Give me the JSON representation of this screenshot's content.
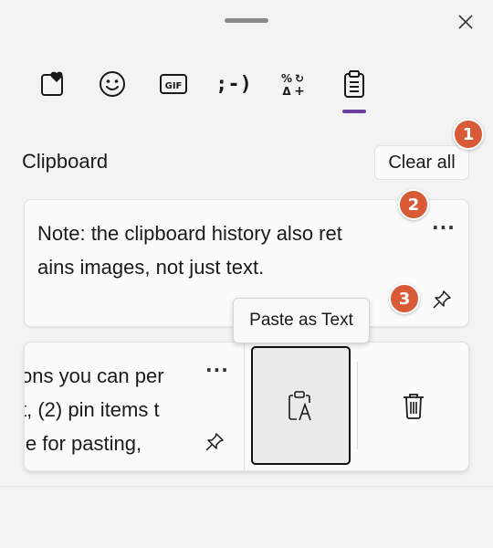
{
  "tabs": [
    {
      "name": "heart-icon",
      "label": ""
    },
    {
      "name": "smiley-icon",
      "label": ""
    },
    {
      "name": "gif-icon",
      "label": "GIF"
    },
    {
      "name": "kaomoji-icon",
      "label": ";-)"
    },
    {
      "name": "symbols-icon",
      "label": "%↻Δ+"
    },
    {
      "name": "clipboard-icon",
      "label": ""
    }
  ],
  "active_tab": "clipboard",
  "section": {
    "title": "Clipboard",
    "clear_all_label": "Clear all"
  },
  "badges": [
    "1",
    "2",
    "3"
  ],
  "items": [
    {
      "lines": [
        "Note: the clipboard history also ret",
        "ains images, not just text."
      ],
      "more_label": "···"
    },
    {
      "lines": [
        "ons you can per",
        "t, (2) pin items t",
        "le for pasting,"
      ],
      "more_label": "···"
    }
  ],
  "tooltip": "Paste as Text",
  "icons": {
    "close": "close-icon",
    "pin": "pin-icon",
    "paste_as_text": "paste-as-text-icon",
    "delete": "trash-icon"
  },
  "colors": {
    "accent_underline": "#6b3fa0",
    "badge": "#d85a36",
    "background": "#f3f3f3"
  }
}
